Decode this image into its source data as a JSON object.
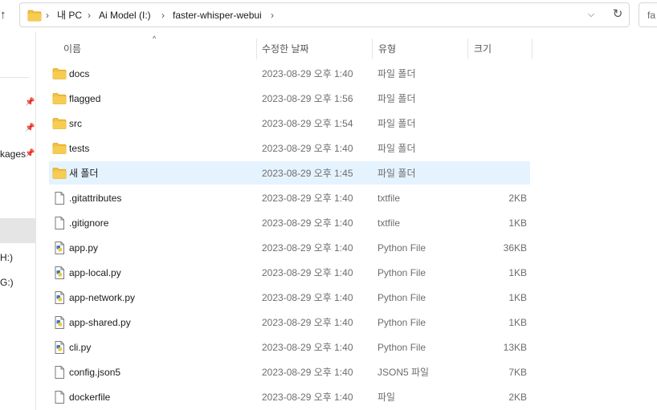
{
  "address": {
    "breadcrumb": [
      "내 PC",
      "Ai Model (I:)",
      "faster-whisper-webui"
    ],
    "separator": "›",
    "search_text": "fa",
    "folder_color": "#f4c042"
  },
  "nav": {
    "pins": [
      "📌",
      "📌",
      "📌"
    ],
    "texts": [
      "kages",
      "H:)",
      "G:)"
    ]
  },
  "columns": {
    "name": "이름",
    "date": "수정한 날짜",
    "type": "유형",
    "size": "크기"
  },
  "files": [
    {
      "name": "docs",
      "date": "2023-08-29 오후 1:40",
      "type": "파일 폴더",
      "size": "",
      "icon": "folder-icon"
    },
    {
      "name": "flagged",
      "date": "2023-08-29 오후 1:56",
      "type": "파일 폴더",
      "size": "",
      "icon": "folder-icon"
    },
    {
      "name": "src",
      "date": "2023-08-29 오후 1:54",
      "type": "파일 폴더",
      "size": "",
      "icon": "folder-icon"
    },
    {
      "name": "tests",
      "date": "2023-08-29 오후 1:40",
      "type": "파일 폴더",
      "size": "",
      "icon": "folder-icon"
    },
    {
      "name": "새 폴더",
      "date": "2023-08-29 오후 1:45",
      "type": "파일 폴더",
      "size": "",
      "icon": "folder-icon",
      "selected": true
    },
    {
      "name": ".gitattributes",
      "date": "2023-08-29 오후 1:40",
      "type": "txtfile",
      "size": "2KB",
      "icon": "document-icon"
    },
    {
      "name": ".gitignore",
      "date": "2023-08-29 오후 1:40",
      "type": "txtfile",
      "size": "1KB",
      "icon": "document-icon"
    },
    {
      "name": "app.py",
      "date": "2023-08-29 오후 1:40",
      "type": "Python File",
      "size": "36KB",
      "icon": "python-file-icon"
    },
    {
      "name": "app-local.py",
      "date": "2023-08-29 오후 1:40",
      "type": "Python File",
      "size": "1KB",
      "icon": "python-file-icon"
    },
    {
      "name": "app-network.py",
      "date": "2023-08-29 오후 1:40",
      "type": "Python File",
      "size": "1KB",
      "icon": "python-file-icon"
    },
    {
      "name": "app-shared.py",
      "date": "2023-08-29 오후 1:40",
      "type": "Python File",
      "size": "1KB",
      "icon": "python-file-icon"
    },
    {
      "name": "cli.py",
      "date": "2023-08-29 오후 1:40",
      "type": "Python File",
      "size": "13KB",
      "icon": "python-file-icon"
    },
    {
      "name": "config.json5",
      "date": "2023-08-29 오후 1:40",
      "type": "JSON5 파일",
      "size": "7KB",
      "icon": "document-icon"
    },
    {
      "name": "dockerfile",
      "date": "2023-08-29 오후 1:40",
      "type": "파일",
      "size": "2KB",
      "icon": "document-icon"
    }
  ],
  "colors": {
    "selection": "#e5f3ff",
    "nav_selected": "#e5e5e5",
    "folder": "#f4c042",
    "python_blue": "#3d7ab8",
    "python_yellow": "#f2c744"
  }
}
